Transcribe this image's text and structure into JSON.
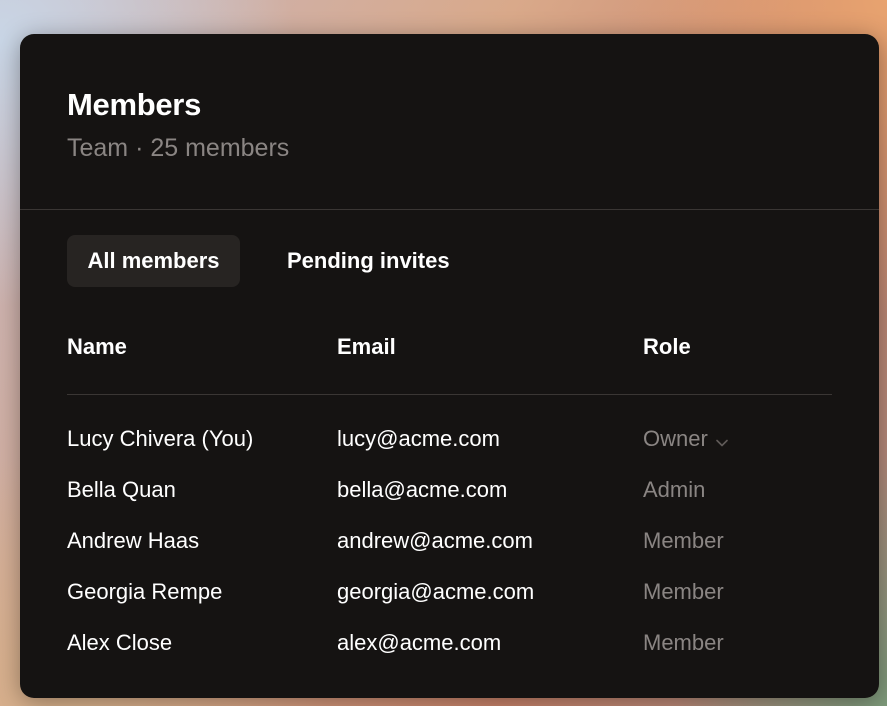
{
  "header": {
    "title": "Members",
    "subtitle": "Team · 25 members"
  },
  "tabs": [
    {
      "label": "All members",
      "active": true
    },
    {
      "label": "Pending invites",
      "active": false
    }
  ],
  "table": {
    "columns": [
      "Name",
      "Email",
      "Role"
    ],
    "rows": [
      {
        "name": "Lucy Chivera (You)",
        "email": "lucy@acme.com",
        "role": "Owner",
        "role_dropdown": true
      },
      {
        "name": "Bella Quan",
        "email": "bella@acme.com",
        "role": "Admin",
        "role_dropdown": false
      },
      {
        "name": "Andrew Haas",
        "email": "andrew@acme.com",
        "role": "Member",
        "role_dropdown": false
      },
      {
        "name": "Georgia Rempe",
        "email": "georgia@acme.com",
        "role": "Member",
        "role_dropdown": false
      },
      {
        "name": "Alex Close",
        "email": "alex@acme.com",
        "role": "Member",
        "role_dropdown": false
      }
    ]
  },
  "colors": {
    "panel": "#151312",
    "text": "#ffffff",
    "muted": "#8a8583",
    "active_tab": "#272422"
  }
}
